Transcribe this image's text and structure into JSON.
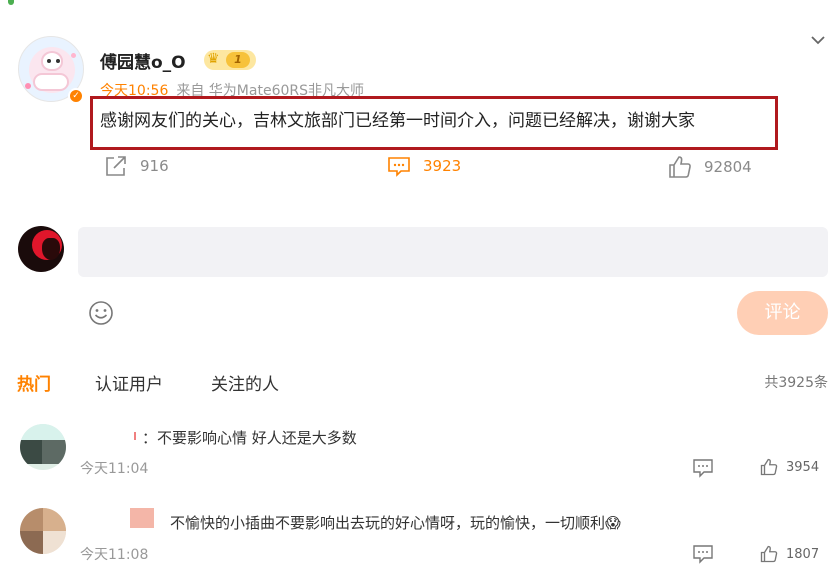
{
  "post": {
    "username": "傅园慧o_O",
    "level_badge": "1",
    "time": "今天10:56",
    "source": "来自 华为Mate60RS非凡大师",
    "text": "感谢网友们的关心，吉林文旅部门已经第一时间介入，问题已经解决，谢谢大家",
    "shares": "916",
    "comments": "3923",
    "likes": "92804"
  },
  "compose": {
    "placeholder": "",
    "submit_label": "评论"
  },
  "tabs": [
    {
      "label": "热门"
    },
    {
      "label": "认证用户"
    },
    {
      "label": "关注的人"
    }
  ],
  "total": "共3925条",
  "comments_list": [
    {
      "text": "：不要影响心情 好人还是大多数",
      "time": "今天11:04",
      "likes": "3954"
    },
    {
      "text": "不愉快的小插曲不要影响出去玩的好心情呀，玩的愉快，一切顺利😱",
      "time": "今天11:08",
      "likes": "1807"
    }
  ],
  "colors": {
    "accent": "#ff8200",
    "highlight_border": "#b0191e",
    "submit_bg": "#ffcfb5"
  },
  "icons": [
    "share-icon",
    "comment-icon",
    "like-icon",
    "emoji-icon",
    "chevron-down-icon",
    "crown-icon",
    "verified-icon"
  ]
}
